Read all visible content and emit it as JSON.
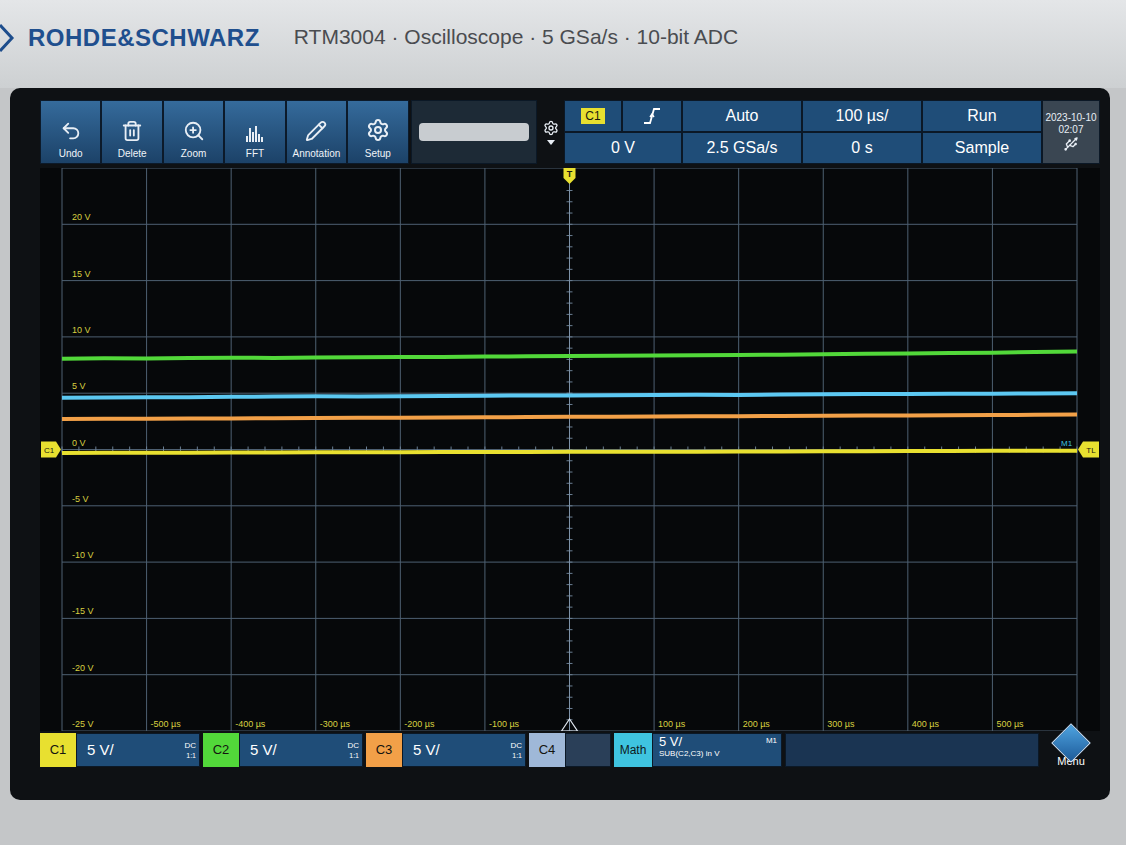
{
  "header": {
    "brand": "ROHDE&SCHWARZ",
    "model": "RTM3004 · Oscilloscope · 5 GSa/s · 10-bit ADC"
  },
  "toolbar": [
    {
      "label": "Undo"
    },
    {
      "label": "Delete"
    },
    {
      "label": "Zoom"
    },
    {
      "label": "FFT"
    },
    {
      "label": "Annotation"
    },
    {
      "label": "Setup"
    }
  ],
  "trigger": {
    "source": "C1",
    "source_color": "#e8e030",
    "level": "0 V",
    "mode": "Auto",
    "sample_rate": "2.5 GSa/s",
    "timebase": "100 µs/",
    "position": "0 s",
    "run_state": "Run",
    "acquisition": "Sample",
    "date": "2023-10-10",
    "time": "02:07"
  },
  "plot": {
    "y_ticks": [
      {
        "label": "20 V",
        "value": 20
      },
      {
        "label": "15 V",
        "value": 15
      },
      {
        "label": "10 V",
        "value": 10
      },
      {
        "label": "5 V",
        "value": 5
      },
      {
        "label": "0 V",
        "value": 0
      },
      {
        "label": "-5 V",
        "value": -5
      },
      {
        "label": "-10 V",
        "value": -10
      },
      {
        "label": "-15 V",
        "value": -15
      },
      {
        "label": "-20 V",
        "value": -20
      },
      {
        "label": "-25 V",
        "value": -25
      }
    ],
    "x_ticks": [
      {
        "label": "-500 µs",
        "value": -500
      },
      {
        "label": "-400 µs",
        "value": -400
      },
      {
        "label": "-300 µs",
        "value": -300
      },
      {
        "label": "-200 µs",
        "value": -200
      },
      {
        "label": "-100 µs",
        "value": -100
      },
      {
        "label": "100 µs",
        "value": 100
      },
      {
        "label": "200 µs",
        "value": 200
      },
      {
        "label": "300 µs",
        "value": 300
      },
      {
        "label": "400 µs",
        "value": 400
      },
      {
        "label": "500 µs",
        "value": 500
      }
    ],
    "traces": [
      {
        "name": "C2",
        "color": "#52d83a",
        "values": [
          8.05,
          8.1,
          8.08,
          8.12,
          8.15,
          8.13,
          8.18,
          8.2,
          8.22,
          8.21,
          8.25,
          8.28,
          8.3,
          8.32,
          8.35,
          8.37,
          8.4,
          8.42,
          8.45,
          8.5,
          8.52,
          8.56,
          8.6,
          8.65,
          8.7
        ]
      },
      {
        "name": "M1",
        "color": "#5cc8f2",
        "values": [
          4.6,
          4.62,
          4.65,
          4.63,
          4.68,
          4.7,
          4.72,
          4.71,
          4.74,
          4.76,
          4.78,
          4.8,
          4.79,
          4.82,
          4.84,
          4.86,
          4.85,
          4.88,
          4.9,
          4.92,
          4.93,
          4.95,
          4.96,
          4.98,
          5.0
        ]
      },
      {
        "name": "C3",
        "color": "#f2a048",
        "values": [
          2.7,
          2.72,
          2.73,
          2.75,
          2.76,
          2.78,
          2.8,
          2.81,
          2.83,
          2.85,
          2.86,
          2.88,
          2.9,
          2.91,
          2.93,
          2.95,
          2.96,
          2.98,
          3.0,
          3.01,
          3.03,
          3.05,
          3.06,
          3.08,
          3.1
        ]
      },
      {
        "name": "C1",
        "color": "#e8e030",
        "values": [
          -0.3,
          -0.29,
          -0.28,
          -0.28,
          -0.27,
          -0.26,
          -0.25,
          -0.25,
          -0.24,
          -0.23,
          -0.22,
          -0.22,
          -0.21,
          -0.2,
          -0.19,
          -0.19,
          -0.18,
          -0.17,
          -0.16,
          -0.15,
          -0.14,
          -0.13,
          -0.12,
          -0.11,
          -0.1
        ]
      }
    ],
    "markers": {
      "channel": "C1",
      "trigger_level": "TL",
      "math": "M1",
      "trigger": "T"
    }
  },
  "channels": [
    {
      "name": "C1",
      "scale": "5 V/",
      "coupling": "DC",
      "ratio": "1:1",
      "color": "#e8e030",
      "active": true
    },
    {
      "name": "C2",
      "scale": "5 V/",
      "coupling": "DC",
      "ratio": "1:1",
      "color": "#52d83a",
      "active": true
    },
    {
      "name": "C3",
      "scale": "5 V/",
      "coupling": "DC",
      "ratio": "1:1",
      "color": "#f2a048",
      "active": true
    },
    {
      "name": "C4",
      "scale": "",
      "coupling": "",
      "ratio": "",
      "color": "#9fb8d8",
      "active": false
    }
  ],
  "math": {
    "label": "Math",
    "scale": "5 V/",
    "expression": "SUB(C2,C3) in V",
    "id": "M1",
    "color": "#3fc4e0"
  },
  "menu": "Menu"
}
